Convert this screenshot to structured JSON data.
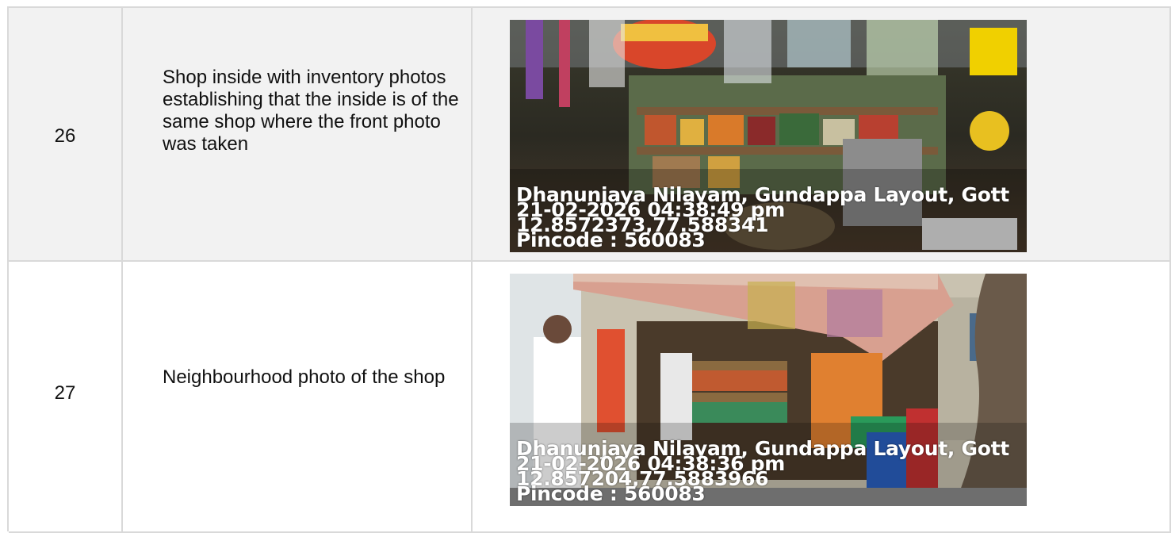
{
  "rows": [
    {
      "number": "26",
      "description": "Shop inside with inventory photos establishing that the inside is of the same shop where the front photo was taken",
      "stamp": {
        "address": "Dhanunjaya Nilayam, Gundappa Layout, Gott",
        "datetime": "21-02-2026 04:38:49 pm",
        "coords": "12.8572373,77.588341",
        "pincode": "Pincode : 560083"
      }
    },
    {
      "number": "27",
      "description": "Neighbourhood photo of the shop",
      "stamp": {
        "address": "Dhanunjaya Nilayam, Gundappa Layout, Gott",
        "datetime": "21-02-2026 04:38:36 pm",
        "coords": "12.857204,77.5883966",
        "pincode": "Pincode : 560083"
      }
    }
  ]
}
